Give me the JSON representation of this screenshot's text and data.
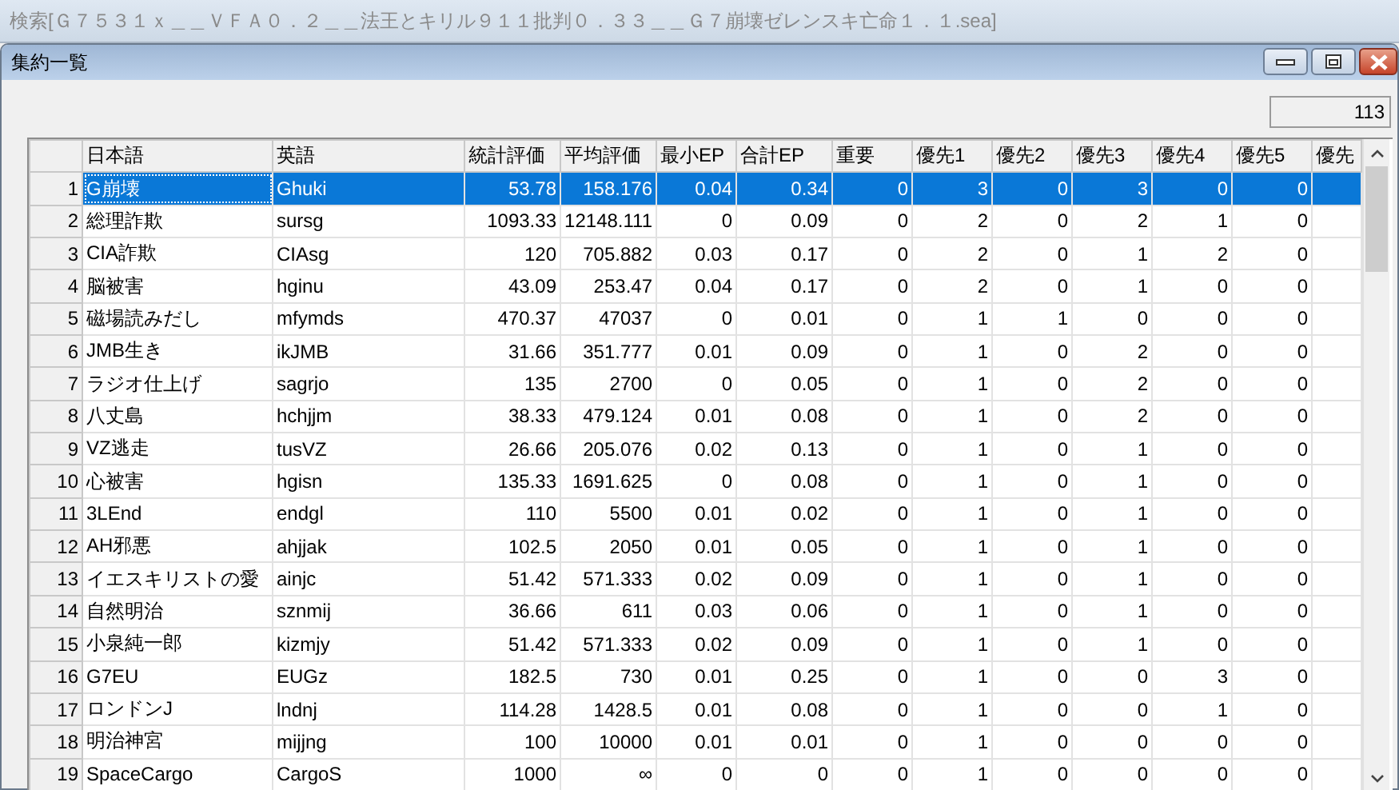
{
  "window": {
    "title": "検索[Ｇ７５３１ｘ＿＿ＶＦＡ０．２＿＿法王とキリル９１１批判０．３３＿＿Ｇ７崩壊ゼレンスキ亡命１．１.sea]"
  },
  "child_window": {
    "title": "集約一覧"
  },
  "count_field": {
    "value": "113"
  },
  "table": {
    "columns": [
      {
        "label": "日本語",
        "kind": "text"
      },
      {
        "label": "英語",
        "kind": "text"
      },
      {
        "label": "統計評価",
        "kind": "number"
      },
      {
        "label": "平均評価",
        "kind": "number"
      },
      {
        "label": "最小EP",
        "kind": "number"
      },
      {
        "label": "合計EP",
        "kind": "number"
      },
      {
        "label": "重要",
        "kind": "number"
      },
      {
        "label": "優先1",
        "kind": "number"
      },
      {
        "label": "優先2",
        "kind": "number"
      },
      {
        "label": "優先3",
        "kind": "number"
      },
      {
        "label": "優先4",
        "kind": "number"
      },
      {
        "label": "優先5",
        "kind": "number"
      },
      {
        "label": "優先",
        "kind": "number"
      }
    ],
    "rows": [
      {
        "number": "1",
        "selected": true,
        "cells": [
          "G崩壊",
          "Ghuki",
          "53.78",
          "158.176",
          "0.04",
          "0.34",
          "0",
          "3",
          "0",
          "3",
          "0",
          "0"
        ]
      },
      {
        "number": "2",
        "selected": false,
        "cells": [
          "総理詐欺",
          "sursg",
          "1093.33",
          "12148.111",
          "0",
          "0.09",
          "0",
          "2",
          "0",
          "2",
          "1",
          "0"
        ]
      },
      {
        "number": "3",
        "selected": false,
        "cells": [
          "CIA詐欺",
          "CIAsg",
          "120",
          "705.882",
          "0.03",
          "0.17",
          "0",
          "2",
          "0",
          "1",
          "2",
          "0"
        ]
      },
      {
        "number": "4",
        "selected": false,
        "cells": [
          "脳被害",
          "hginu",
          "43.09",
          "253.47",
          "0.04",
          "0.17",
          "0",
          "2",
          "0",
          "1",
          "0",
          "0"
        ]
      },
      {
        "number": "5",
        "selected": false,
        "cells": [
          "磁場読みだし",
          "mfymds",
          "470.37",
          "47037",
          "0",
          "0.01",
          "0",
          "1",
          "1",
          "0",
          "0",
          "0"
        ]
      },
      {
        "number": "6",
        "selected": false,
        "cells": [
          "JMB生き",
          "ikJMB",
          "31.66",
          "351.777",
          "0.01",
          "0.09",
          "0",
          "1",
          "0",
          "2",
          "0",
          "0"
        ]
      },
      {
        "number": "7",
        "selected": false,
        "cells": [
          "ラジオ仕上げ",
          "sagrjo",
          "135",
          "2700",
          "0",
          "0.05",
          "0",
          "1",
          "0",
          "2",
          "0",
          "0"
        ]
      },
      {
        "number": "8",
        "selected": false,
        "cells": [
          "八丈島",
          "hchjjm",
          "38.33",
          "479.124",
          "0.01",
          "0.08",
          "0",
          "1",
          "0",
          "2",
          "0",
          "0"
        ]
      },
      {
        "number": "9",
        "selected": false,
        "cells": [
          "VZ逃走",
          "tusVZ",
          "26.66",
          "205.076",
          "0.02",
          "0.13",
          "0",
          "1",
          "0",
          "1",
          "0",
          "0"
        ]
      },
      {
        "number": "10",
        "selected": false,
        "cells": [
          "心被害",
          "hgisn",
          "135.33",
          "1691.625",
          "0",
          "0.08",
          "0",
          "1",
          "0",
          "1",
          "0",
          "0"
        ]
      },
      {
        "number": "11",
        "selected": false,
        "cells": [
          "3LEnd",
          "endgl",
          "110",
          "5500",
          "0.01",
          "0.02",
          "0",
          "1",
          "0",
          "1",
          "0",
          "0"
        ]
      },
      {
        "number": "12",
        "selected": false,
        "cells": [
          "AH邪悪",
          "ahjjak",
          "102.5",
          "2050",
          "0.01",
          "0.05",
          "0",
          "1",
          "0",
          "1",
          "0",
          "0"
        ]
      },
      {
        "number": "13",
        "selected": false,
        "cells": [
          "イエスキリストの愛",
          "ainjc",
          "51.42",
          "571.333",
          "0.02",
          "0.09",
          "0",
          "1",
          "0",
          "1",
          "0",
          "0"
        ]
      },
      {
        "number": "14",
        "selected": false,
        "cells": [
          "自然明治",
          "sznmij",
          "36.66",
          "611",
          "0.03",
          "0.06",
          "0",
          "1",
          "0",
          "1",
          "0",
          "0"
        ]
      },
      {
        "number": "15",
        "selected": false,
        "cells": [
          "小泉純一郎",
          "kizmjy",
          "51.42",
          "571.333",
          "0.02",
          "0.09",
          "0",
          "1",
          "0",
          "1",
          "0",
          "0"
        ]
      },
      {
        "number": "16",
        "selected": false,
        "cells": [
          "G7EU",
          "EUGz",
          "182.5",
          "730",
          "0.01",
          "0.25",
          "0",
          "1",
          "0",
          "0",
          "3",
          "0"
        ]
      },
      {
        "number": "17",
        "selected": false,
        "cells": [
          "ロンドンJ",
          "lndnj",
          "114.28",
          "1428.5",
          "0.01",
          "0.08",
          "0",
          "1",
          "0",
          "0",
          "1",
          "0"
        ]
      },
      {
        "number": "18",
        "selected": false,
        "cells": [
          "明治神宮",
          "mijjng",
          "100",
          "10000",
          "0.01",
          "0.01",
          "0",
          "1",
          "0",
          "0",
          "0",
          "0"
        ]
      },
      {
        "number": "19",
        "selected": false,
        "cells": [
          "SpaceCargo",
          "CargoS",
          "1000",
          "∞",
          "0",
          "0",
          "0",
          "1",
          "0",
          "0",
          "0",
          "0"
        ]
      }
    ]
  }
}
